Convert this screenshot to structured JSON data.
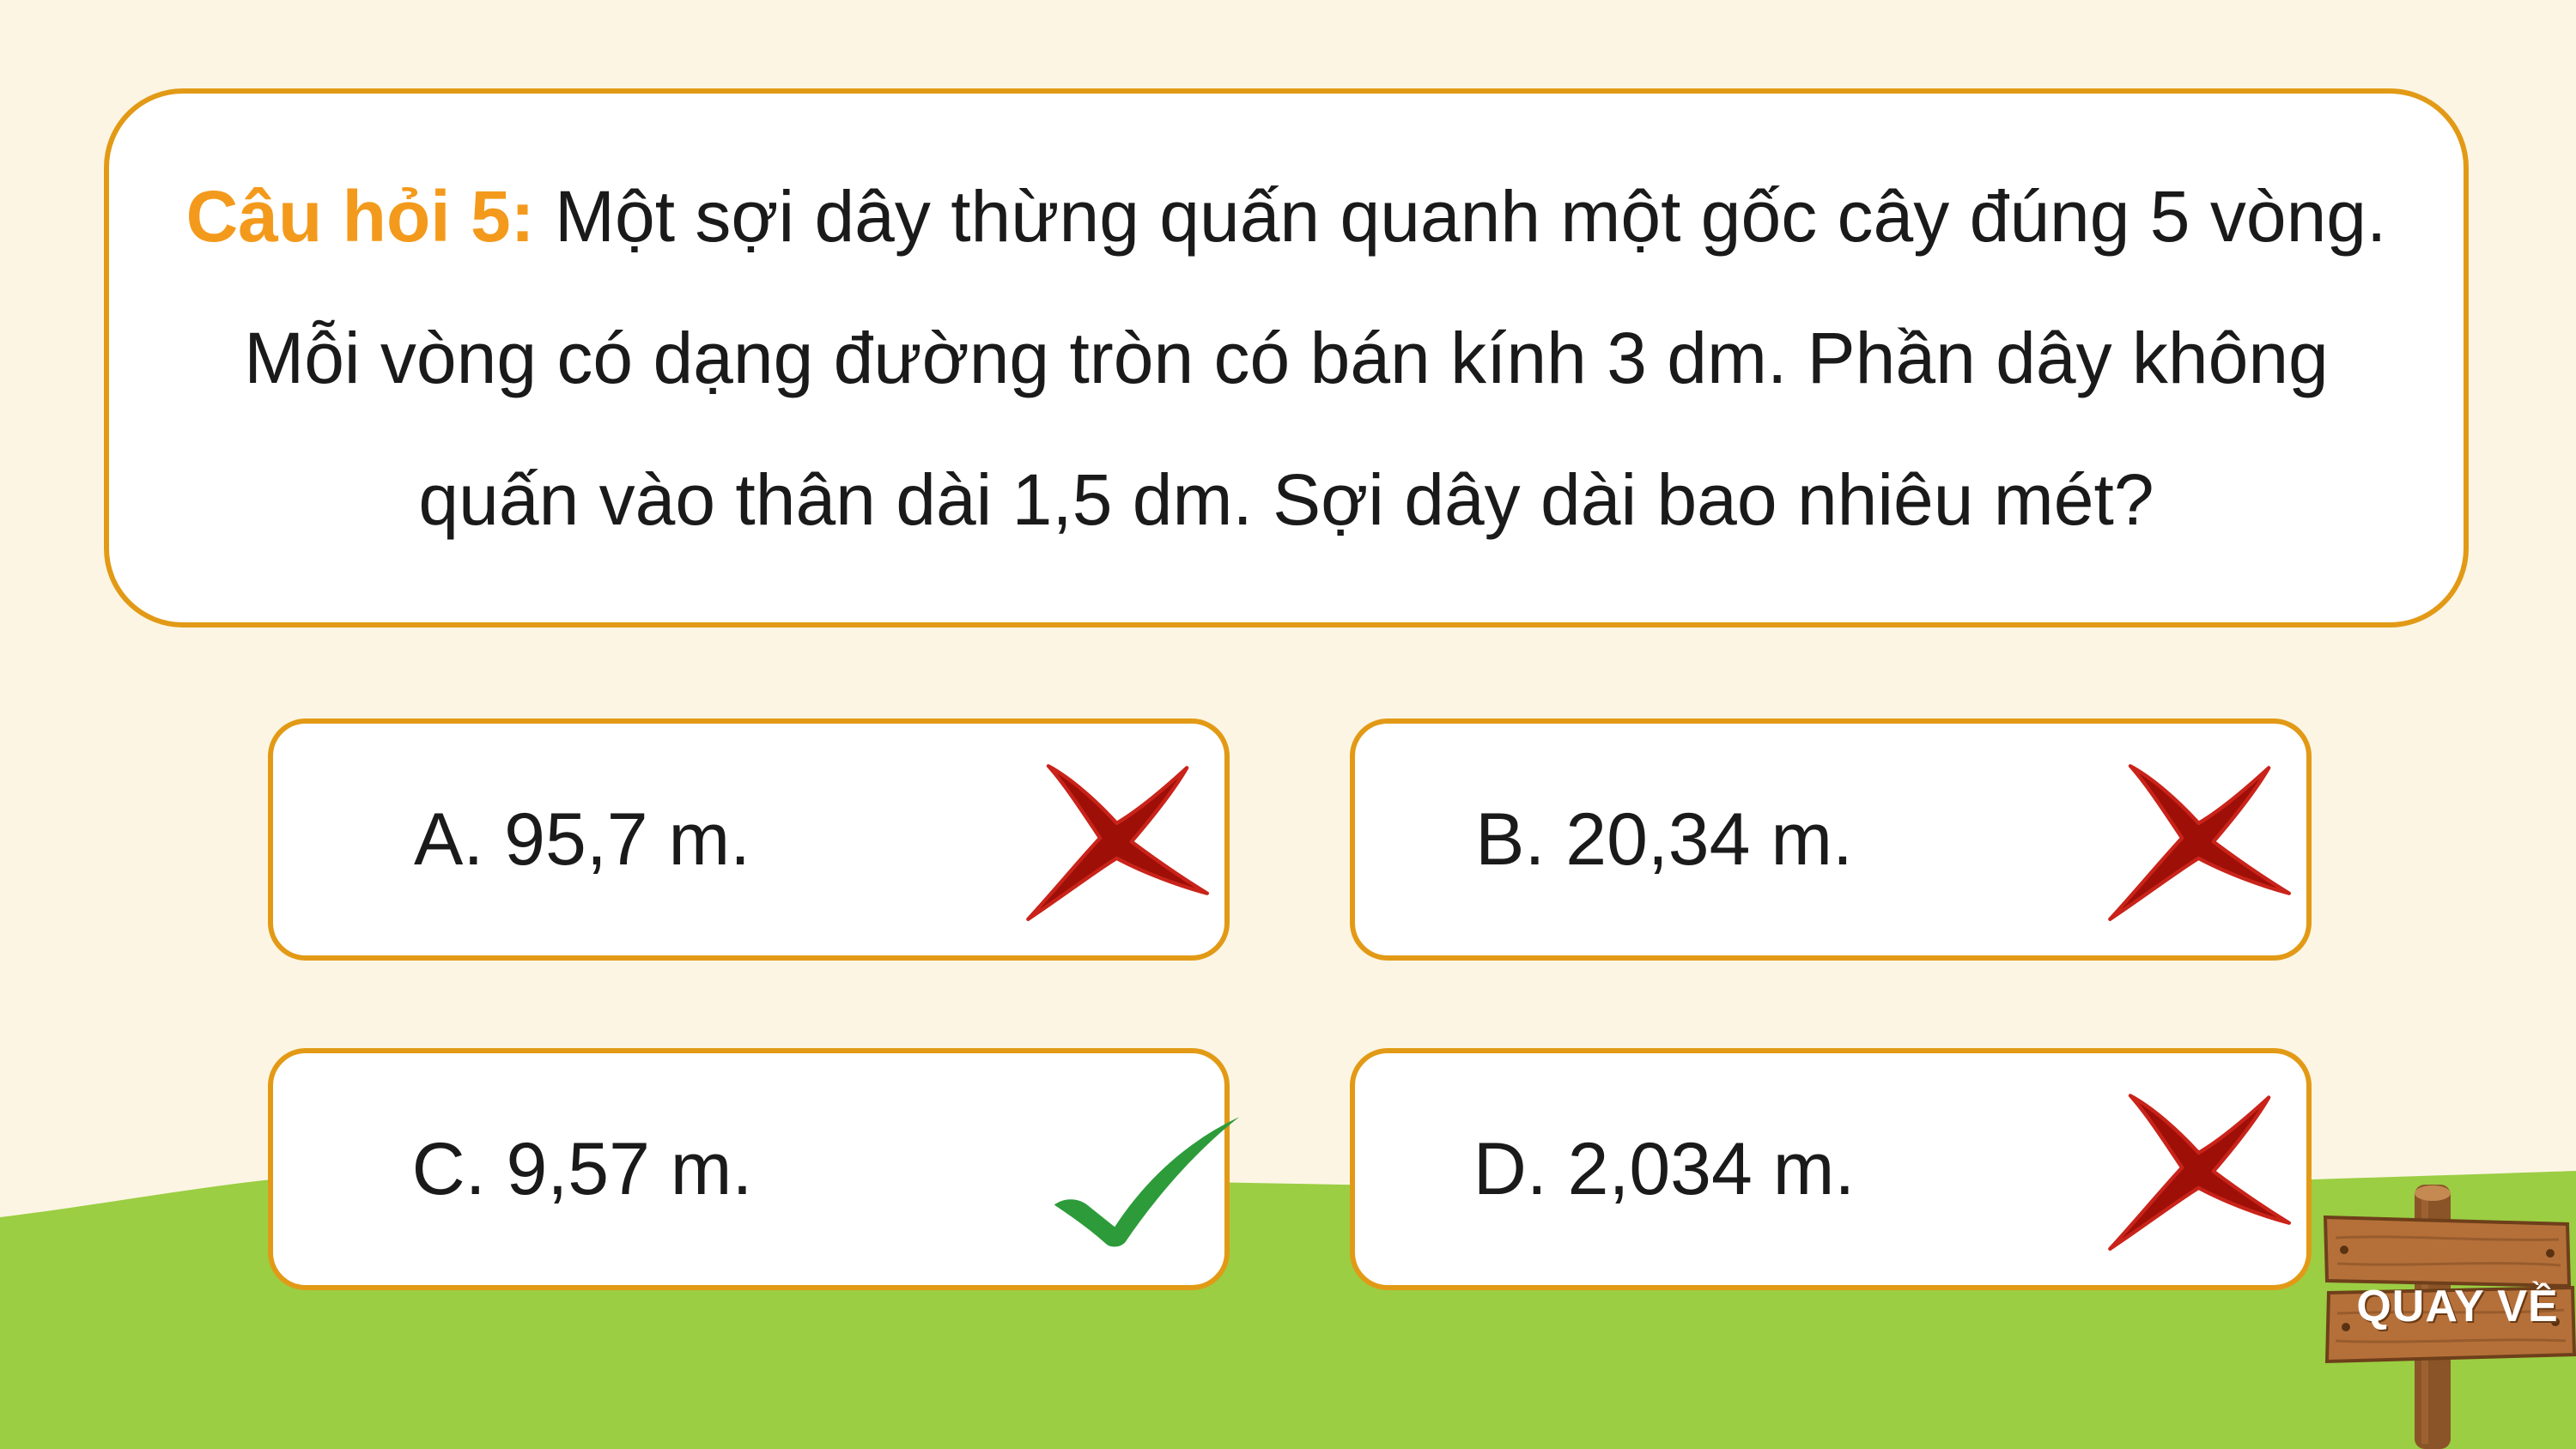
{
  "question": {
    "label": "Câu hỏi 5:",
    "text": "Một sợi dây thừng quấn quanh một gốc cây đúng 5 vòng. Mỗi vòng có dạng đường tròn có bán kính 3 dm. Phần dây không quấn vào thân dài 1,5 dm. Sợi dây dài bao nhiêu mét?"
  },
  "answers": [
    {
      "text": "A. 95,7 m.",
      "mark_icon": "cross-icon",
      "correct": false
    },
    {
      "text": "B. 20,34 m.",
      "mark_icon": "cross-icon",
      "correct": false
    },
    {
      "text": "C. 9,57 m.",
      "mark_icon": "check-icon",
      "correct": true
    },
    {
      "text": "D. 2,034 m.",
      "mark_icon": "cross-icon",
      "correct": false
    }
  ],
  "back_button": {
    "label": "QUAY VỀ",
    "icon": "wooden-signpost-icon"
  },
  "colors": {
    "background": "#fcf5e3",
    "accent_orange": "#f39a1c",
    "border_orange": "#e29a16",
    "grass": "#9bce43",
    "cross_red": "#9e0f08",
    "check_green": "#2d9b3a",
    "wood": "#b5703a"
  }
}
